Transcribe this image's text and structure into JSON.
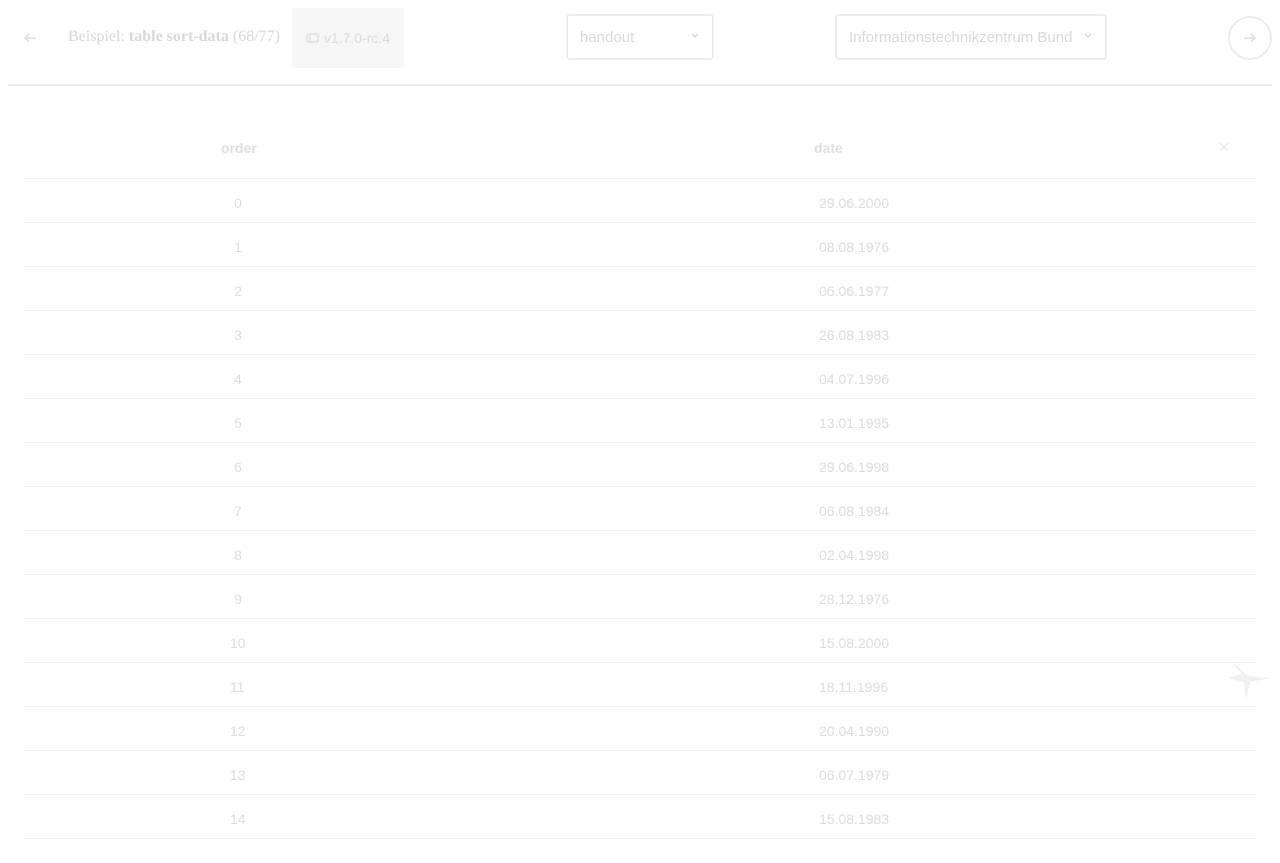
{
  "header": {
    "title_prefix": "Beispiel:",
    "title_main": "table sort-data",
    "title_count": "(68/77)",
    "version": "v1.7.0-rc.4",
    "variant_select": "handout",
    "ministry_select": "Informationstechnikzentrum Bund"
  },
  "table": {
    "columns": [
      "order",
      "date"
    ],
    "rows": [
      {
        "order": "0",
        "date": "29.06.2000"
      },
      {
        "order": "1",
        "date": "08.08.1976"
      },
      {
        "order": "2",
        "date": "06.06.1977"
      },
      {
        "order": "3",
        "date": "26.08.1983"
      },
      {
        "order": "4",
        "date": "04.07.1996"
      },
      {
        "order": "5",
        "date": "13.01.1995"
      },
      {
        "order": "6",
        "date": "29.06.1998"
      },
      {
        "order": "7",
        "date": "06.08.1984"
      },
      {
        "order": "8",
        "date": "02.04.1998"
      },
      {
        "order": "9",
        "date": "28.12.1976"
      },
      {
        "order": "10",
        "date": "15.08.2000"
      },
      {
        "order": "11",
        "date": "18.11.1996"
      },
      {
        "order": "12",
        "date": "20.04.1990"
      },
      {
        "order": "13",
        "date": "06.07.1979"
      },
      {
        "order": "14",
        "date": "15.08.1983"
      }
    ]
  },
  "icons": {
    "back": "arrow-left-icon",
    "version": "tag-icon",
    "chevron": "chevron-down-icon",
    "next": "arrow-right-icon",
    "close": "close-icon",
    "logo": "eagle-logo-icon"
  }
}
